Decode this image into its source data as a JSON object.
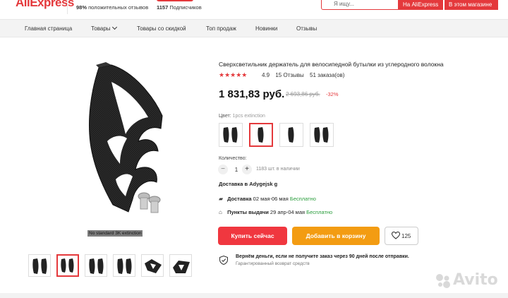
{
  "header": {
    "logo": "AliExpress",
    "positive_reviews_pct": "98%",
    "positive_reviews_label": "положительных отзывов",
    "subscribers_count": "1157",
    "subscribers_label": "Подписчиков",
    "search_placeholder": "Я ищу...",
    "search_aliexpress": "На AliExpress",
    "search_store": "В этом магазине"
  },
  "nav": [
    "Главная страница",
    "Товары",
    "Товары со скидкой",
    "Топ продаж",
    "Новинки",
    "Отзывы"
  ],
  "gallery": {
    "caption": "No standard 3K extinction"
  },
  "product": {
    "title": "Сверхсветильник держатель для велосипедной бутылки из углеродного волокна",
    "stars": "★★★★★",
    "rating": "4.9",
    "reviews": "15 Отзывы",
    "orders": "51 заказа(ов)",
    "price": "1 831,83 руб.",
    "old_price": "2 693,86 руб.",
    "discount": "-32%",
    "color_label": "Цвет:",
    "color_value": "1pcs extinction",
    "qty_label": "Количество:",
    "qty_minus": "−",
    "qty_value": "1",
    "qty_plus": "+",
    "stock": "1183 шт. в наличии",
    "delivery_title": "Доставка в Adygejsk g",
    "delivery_label": "Доставка",
    "delivery_dates": "02 мая-06 мая",
    "delivery_price": "Бесплатно",
    "pickup_label": "Пункты выдачи",
    "pickup_dates": "29 апр-04 мая",
    "pickup_price": "Бесплатно",
    "buy_now": "Купить сейчас",
    "add_to_cart": "Добавить в корзину",
    "wishlist_count": "125",
    "guarantee_title": "Вернём деньги, если не получите заказ через 90 дней после отправки.",
    "guarantee_sub": "Гарантированный возврат средств"
  },
  "watermark": "Avito",
  "colors": {
    "accent": "#e4393c",
    "buy": "#f0373f",
    "cart": "#f39c12",
    "free": "#2a9d3c"
  }
}
